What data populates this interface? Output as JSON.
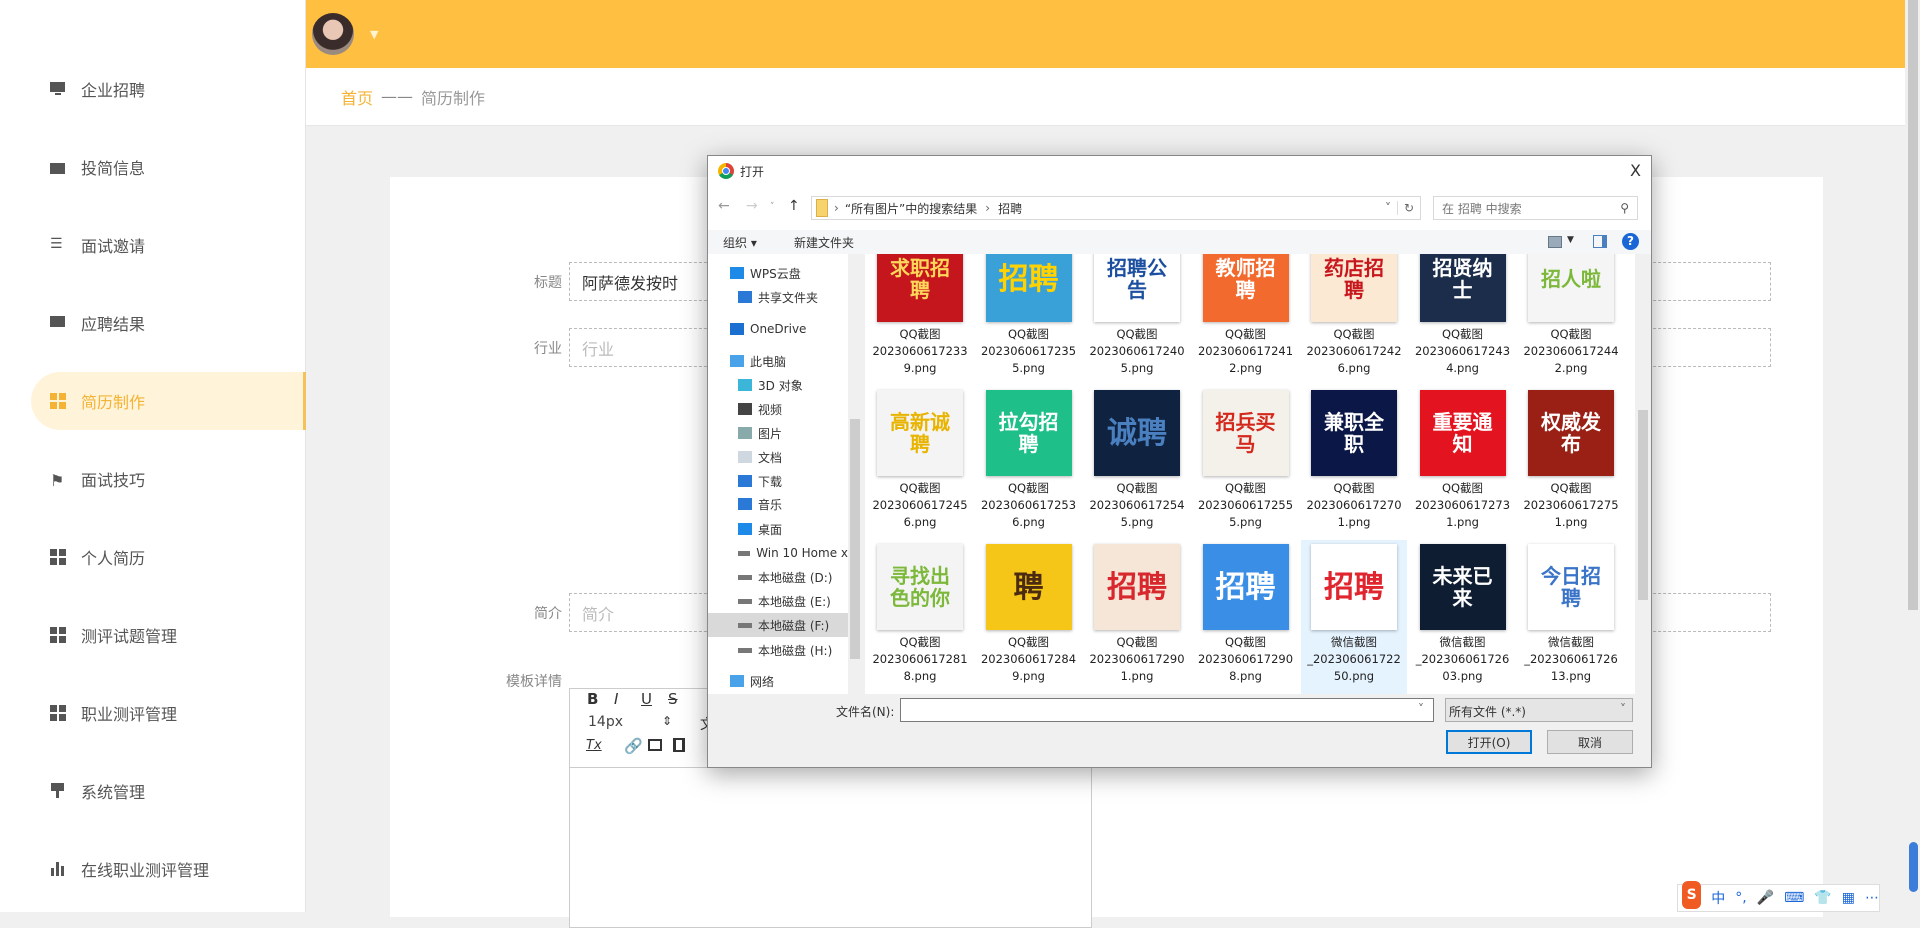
{
  "sidebar": {
    "items": [
      {
        "label": "企业招聘",
        "icon": "monitor-icon"
      },
      {
        "label": "投简信息",
        "icon": "wallet-icon"
      },
      {
        "label": "面试邀请",
        "icon": "sliders-icon"
      },
      {
        "label": "应聘结果",
        "icon": "chat-icon"
      },
      {
        "label": "简历制作",
        "icon": "grid-icon",
        "active": true
      },
      {
        "label": "面试技巧",
        "icon": "flag-icon"
      },
      {
        "label": "个人简历",
        "icon": "grid-icon"
      },
      {
        "label": "测评试题管理",
        "icon": "grid-icon"
      },
      {
        "label": "职业测评管理",
        "icon": "grid-icon"
      },
      {
        "label": "系统管理",
        "icon": "brush-icon"
      },
      {
        "label": "在线职业测评管理",
        "icon": "bar-chart-icon"
      }
    ]
  },
  "header": {
    "caret": "▼"
  },
  "breadcrumb": {
    "home": "首页",
    "sep": "——",
    "current": "简历制作"
  },
  "form": {
    "title_label": "标题",
    "title_value": "阿萨德发按时",
    "industry_label": "行业",
    "industry_placeholder": "行业",
    "intro_label": "简介",
    "intro_placeholder": "简介",
    "detail_label": "模板详情",
    "editor": {
      "bold": "B",
      "italic": "I",
      "underline": "U",
      "strike": "S",
      "font_size": "14px",
      "font_size_arrows": "⇕",
      "partial": "文",
      "clear_format": "Tx"
    }
  },
  "dialog": {
    "title": "打开",
    "close": "X",
    "address": {
      "parts": [
        "“所有图片”中的搜索结果",
        "招聘"
      ]
    },
    "search_placeholder": "在 招聘 中搜索",
    "toolbar": {
      "organize": "组织 ▾",
      "new_folder": "新建文件夹",
      "help": "?"
    },
    "nav": [
      {
        "label": "WPS云盘",
        "icon": "cloud-icon",
        "indent": 1
      },
      {
        "label": "共享文件夹",
        "icon": "share-icon",
        "indent": 2
      },
      {
        "label": "OneDrive",
        "icon": "onedrive-icon",
        "indent": 1
      },
      {
        "label": "此电脑",
        "icon": "computer-icon",
        "indent": 1
      },
      {
        "label": "3D 对象",
        "icon": "cube-icon",
        "indent": 2
      },
      {
        "label": "视频",
        "icon": "video-icon",
        "indent": 2
      },
      {
        "label": "图片",
        "icon": "picture-icon",
        "indent": 2
      },
      {
        "label": "文档",
        "icon": "document-icon",
        "indent": 2
      },
      {
        "label": "下载",
        "icon": "download-icon",
        "indent": 2
      },
      {
        "label": "音乐",
        "icon": "music-icon",
        "indent": 2
      },
      {
        "label": "桌面",
        "icon": "desktop-icon",
        "indent": 2
      },
      {
        "label": "Win 10 Home x",
        "icon": "drive-icon",
        "indent": 2
      },
      {
        "label": "本地磁盘 (D:)",
        "icon": "drive-icon",
        "indent": 2
      },
      {
        "label": "本地磁盘 (E:)",
        "icon": "drive-icon",
        "indent": 2
      },
      {
        "label": "本地磁盘 (F:)",
        "icon": "drive-icon",
        "indent": 2,
        "selected": true
      },
      {
        "label": "本地磁盘 (H:)",
        "icon": "drive-icon",
        "indent": 2
      },
      {
        "label": "网络",
        "icon": "network-icon",
        "indent": 1
      }
    ],
    "files": [
      {
        "name": "QQ截图20230606172339.png",
        "thumb": "求职招聘",
        "bg": "#c4161c",
        "fg": "#ffd75a"
      },
      {
        "name": "QQ截图20230606172355.png",
        "thumb": "招聘",
        "bg": "#3aa0d8",
        "fg": "#ffd200"
      },
      {
        "name": "QQ截图20230606172405.png",
        "thumb": "招聘公告",
        "bg": "#ffffff",
        "fg": "#1c4fa0"
      },
      {
        "name": "QQ截图20230606172412.png",
        "thumb": "教师招聘",
        "bg": "#f26a2e",
        "fg": "#ffffff"
      },
      {
        "name": "QQ截图20230606172426.png",
        "thumb": "药店招聘",
        "bg": "#fbe9d4",
        "fg": "#c8161d"
      },
      {
        "name": "QQ截图20230606172434.png",
        "thumb": "招贤纳士",
        "bg": "#1b2d4a",
        "fg": "#ffffff"
      },
      {
        "name": "QQ截图20230606172442.png",
        "thumb": "招人啦",
        "bg": "#f5f5f5",
        "fg": "#7cb83a"
      },
      {
        "name": "QQ截图20230606172456.png",
        "thumb": "高新诚聘",
        "bg": "#f4f4f4",
        "fg": "#e8b400"
      },
      {
        "name": "QQ截图20230606172536.png",
        "thumb": "拉勾招聘",
        "bg": "#1fbf8a",
        "fg": "#ffffff"
      },
      {
        "name": "QQ截图20230606172545.png",
        "thumb": "诚聘",
        "bg": "#0f2340",
        "fg": "#4a7fc0"
      },
      {
        "name": "QQ截图20230606172555.png",
        "thumb": "招兵买马",
        "bg": "#f4f0ea",
        "fg": "#d4281c"
      },
      {
        "name": "QQ截图20230606172701.png",
        "thumb": "兼职全职",
        "bg": "#0b1747",
        "fg": "#ffffff"
      },
      {
        "name": "QQ截图20230606172731.png",
        "thumb": "重要通知",
        "bg": "#e3141f",
        "fg": "#ffffff"
      },
      {
        "name": "QQ截图20230606172751.png",
        "thumb": "权威发布",
        "bg": "#9a1f14",
        "fg": "#ffffff"
      },
      {
        "name": "QQ截图20230606172818.png",
        "thumb": "寻找出色的你",
        "bg": "#f4f4f4",
        "fg": "#7cb83a"
      },
      {
        "name": "QQ截图20230606172849.png",
        "thumb": "聘",
        "bg": "#f5c518",
        "fg": "#4a2a10"
      },
      {
        "name": "QQ截图20230606172901.png",
        "thumb": "招聘",
        "bg": "#f6e6d8",
        "fg": "#d8282e"
      },
      {
        "name": "QQ截图20230606172908.png",
        "thumb": "招聘",
        "bg": "#3a8ee6",
        "fg": "#ffffff"
      },
      {
        "name": "微信截图_20230606172250.png",
        "thumb": "招聘",
        "bg": "#ffffff",
        "fg": "#e0252e",
        "hover": true
      },
      {
        "name": "微信截图_20230606172603.png",
        "thumb": "未来已来",
        "bg": "#0f1d33",
        "fg": "#ffffff"
      },
      {
        "name": "微信截图_20230606172613.png",
        "thumb": "今日招聘",
        "bg": "#ffffff",
        "fg": "#3a74c8"
      }
    ],
    "filename_label": "文件名(N):",
    "filename_value": "",
    "filter": "所有文件 (*.*)",
    "open": "打开(O)",
    "cancel": "取消"
  },
  "ime": {
    "logo": "S",
    "items": [
      "中",
      "°,",
      "🎤",
      "⌨",
      "👕",
      "▦",
      "⋯"
    ]
  }
}
